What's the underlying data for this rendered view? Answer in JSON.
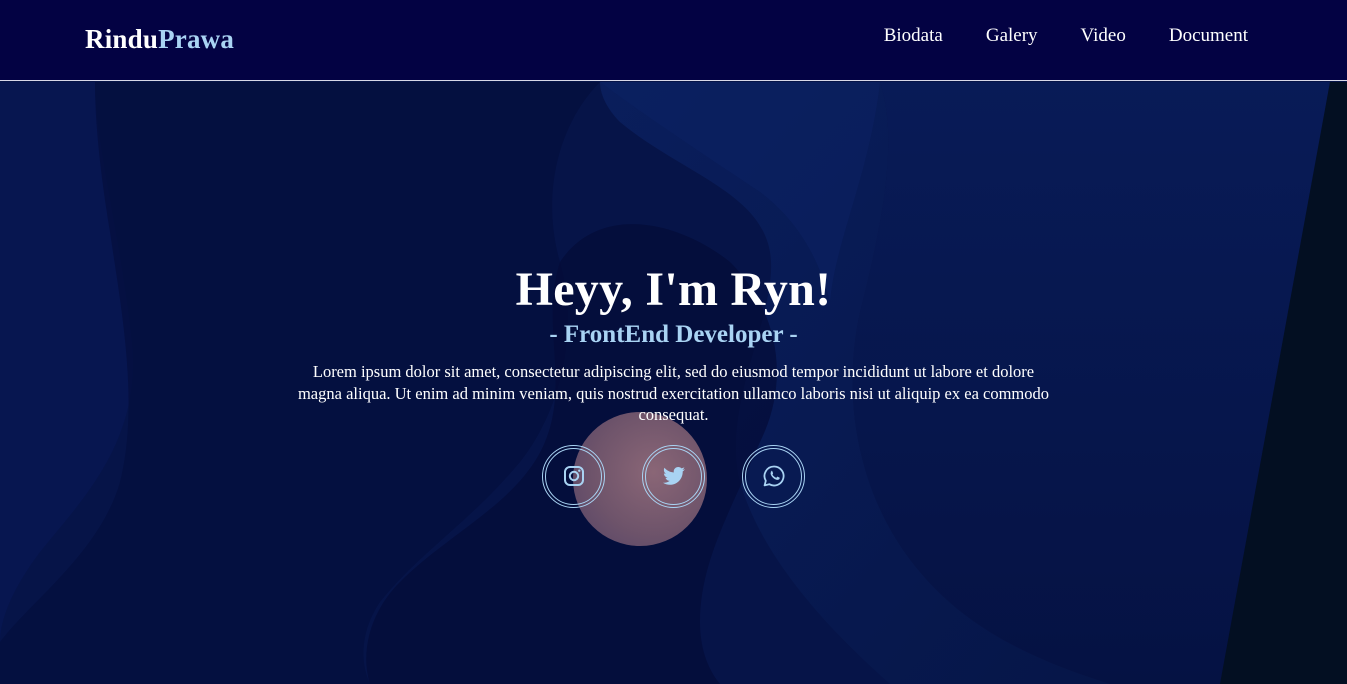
{
  "brand": {
    "part1": "Rindu",
    "part2": "Prawa"
  },
  "nav": {
    "items": [
      {
        "label": "Biodata"
      },
      {
        "label": "Galery"
      },
      {
        "label": "Video"
      },
      {
        "label": "Document"
      }
    ]
  },
  "hero": {
    "title": "Heyy, I'm Ryn!",
    "subtitle": "- FrontEnd Developer -",
    "description": "Lorem ipsum dolor sit amet, consectetur adipiscing elit, sed do eiusmod tempor incididunt ut labore et dolore magna aliqua. Ut enim ad minim veniam, quis nostrud exercitation ullamco laboris nisi ut aliquip ex ea commodo consequat.",
    "socials": [
      {
        "icon": "instagram-icon"
      },
      {
        "icon": "twitter-icon"
      },
      {
        "icon": "whatsapp-icon"
      }
    ]
  },
  "colors": {
    "navbar_bg": "#030243",
    "hero_bg": "#061448",
    "accent": "#a9d3f3",
    "text": "#ffffff"
  }
}
